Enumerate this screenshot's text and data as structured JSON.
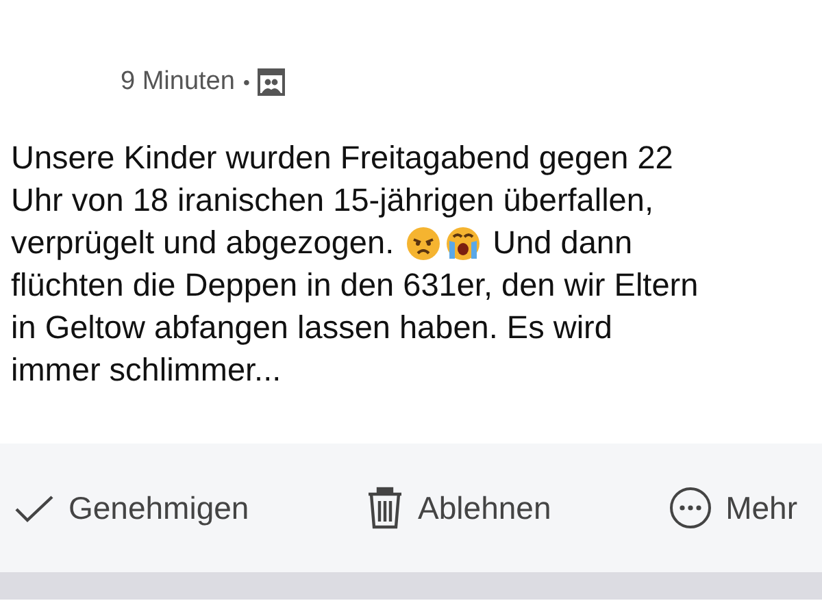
{
  "post": {
    "time": "9 Minuten",
    "separator": "•",
    "lines": [
      [
        "Unsere Kinder wurden Freitagabend gegen 22"
      ],
      [
        "Uhr von 18 iranischen 15-jährigen überfallen,"
      ],
      [
        "verprügelt und abgezogen.",
        "Und dann"
      ],
      [
        "flüchten die Deppen in den 631er, den wir Eltern"
      ],
      [
        "in Geltow abfangen lassen haben. Es wird"
      ],
      [
        "immer schlimmer..."
      ]
    ]
  },
  "actions": [
    {
      "label": "Genehmigen",
      "kind": "approve"
    },
    {
      "label": "Ablehnen",
      "kind": "decline"
    },
    {
      "label": "Mehr",
      "kind": "more"
    }
  ]
}
